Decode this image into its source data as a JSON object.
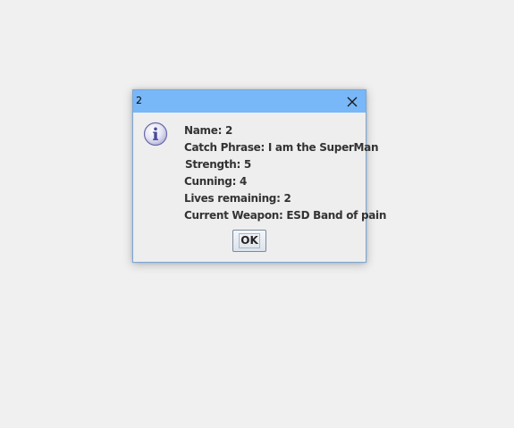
{
  "window": {
    "title": "2",
    "close_icon": "close-icon"
  },
  "dialog": {
    "icon": "info-icon",
    "lines": {
      "name": "Name: 2",
      "catch_phrase": "Catch Phrase: I am the SuperMan",
      "strength": "Strength: 5",
      "cunning": "Cunning: 4",
      "lives": "Lives remaining: 2",
      "weapon": "Current Weapon: ESD Band of pain"
    },
    "ok_label": "OK"
  },
  "colors": {
    "titlebar": "#78b7f8",
    "background": "#f0f0f0",
    "dialog_bg": "#eeeeee"
  }
}
